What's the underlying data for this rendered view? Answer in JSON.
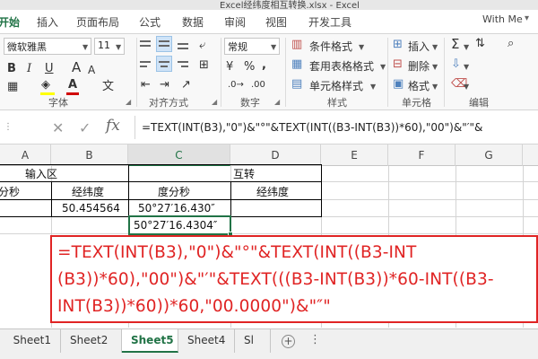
{
  "window": {
    "title": "Excel经纬度相互转换.xlsx - Excel"
  },
  "ribbon_tabs": {
    "file": "开始",
    "insert": "插入",
    "layout": "页面布局",
    "formulas": "公式",
    "data": "数据",
    "review": "审阅",
    "view": "视图",
    "developer": "开发工具"
  },
  "account": {
    "user": "With Me"
  },
  "font_group": {
    "font_name": "微软雅黑",
    "font_size": "11",
    "bold": "B",
    "italic": "I",
    "underline": "U",
    "label": "字体"
  },
  "alignment_group": {
    "label": "对齐方式"
  },
  "number_group": {
    "format": "常规",
    "percent": "%",
    "comma": ",",
    "label": "数字"
  },
  "styles_group": {
    "conditional": "条件格式",
    "table": "套用表格格式",
    "cell_styles": "单元格样式",
    "label": "样式"
  },
  "cells_group": {
    "insert": "插入",
    "delete": "删除",
    "format": "格式",
    "label": "单元格"
  },
  "editing_group": {
    "label": "编辑",
    "sum": "Σ"
  },
  "formula_bar": {
    "fx": "fx",
    "formula": "=TEXT(INT(B3),\"0\")&\"°\"&TEXT(INT((B3-INT(B3))*60),\"00\")&\"′\"&"
  },
  "columns": {
    "A": "A",
    "B": "B",
    "C": "C",
    "D": "D",
    "E": "E",
    "F": "F",
    "G": "G"
  },
  "grid": {
    "row1_a": "输入区",
    "row1_c": "互转",
    "row2_a": "分秒",
    "row2_b": "经纬度",
    "row2_c": "度分秒",
    "row2_d": "经纬度",
    "row3_b": "50.454564",
    "row3_c": "50°27′16.430″",
    "row4_c": "50°27′16.4304″"
  },
  "callout": {
    "line1": "=TEXT(INT(B3),\"0\")&\"°\"&TEXT(INT((B3-INT",
    "line2": "(B3))*60),\"00\")&\"′\"&TEXT(((B3-INT(B3))*60-INT((B3-",
    "line3": "INT(B3))*60))*60,\"00.0000\")&\"″\""
  },
  "sheets": {
    "s1": "Sheet1",
    "s2": "Sheet2",
    "s5": "Sheet5",
    "s4": "Sheet4",
    "s_partial": "Sl"
  },
  "colors": {
    "accent": "#217346",
    "callout_red": "#e02424",
    "font_color": "#d00000",
    "fill_color": "#ffff00"
  }
}
